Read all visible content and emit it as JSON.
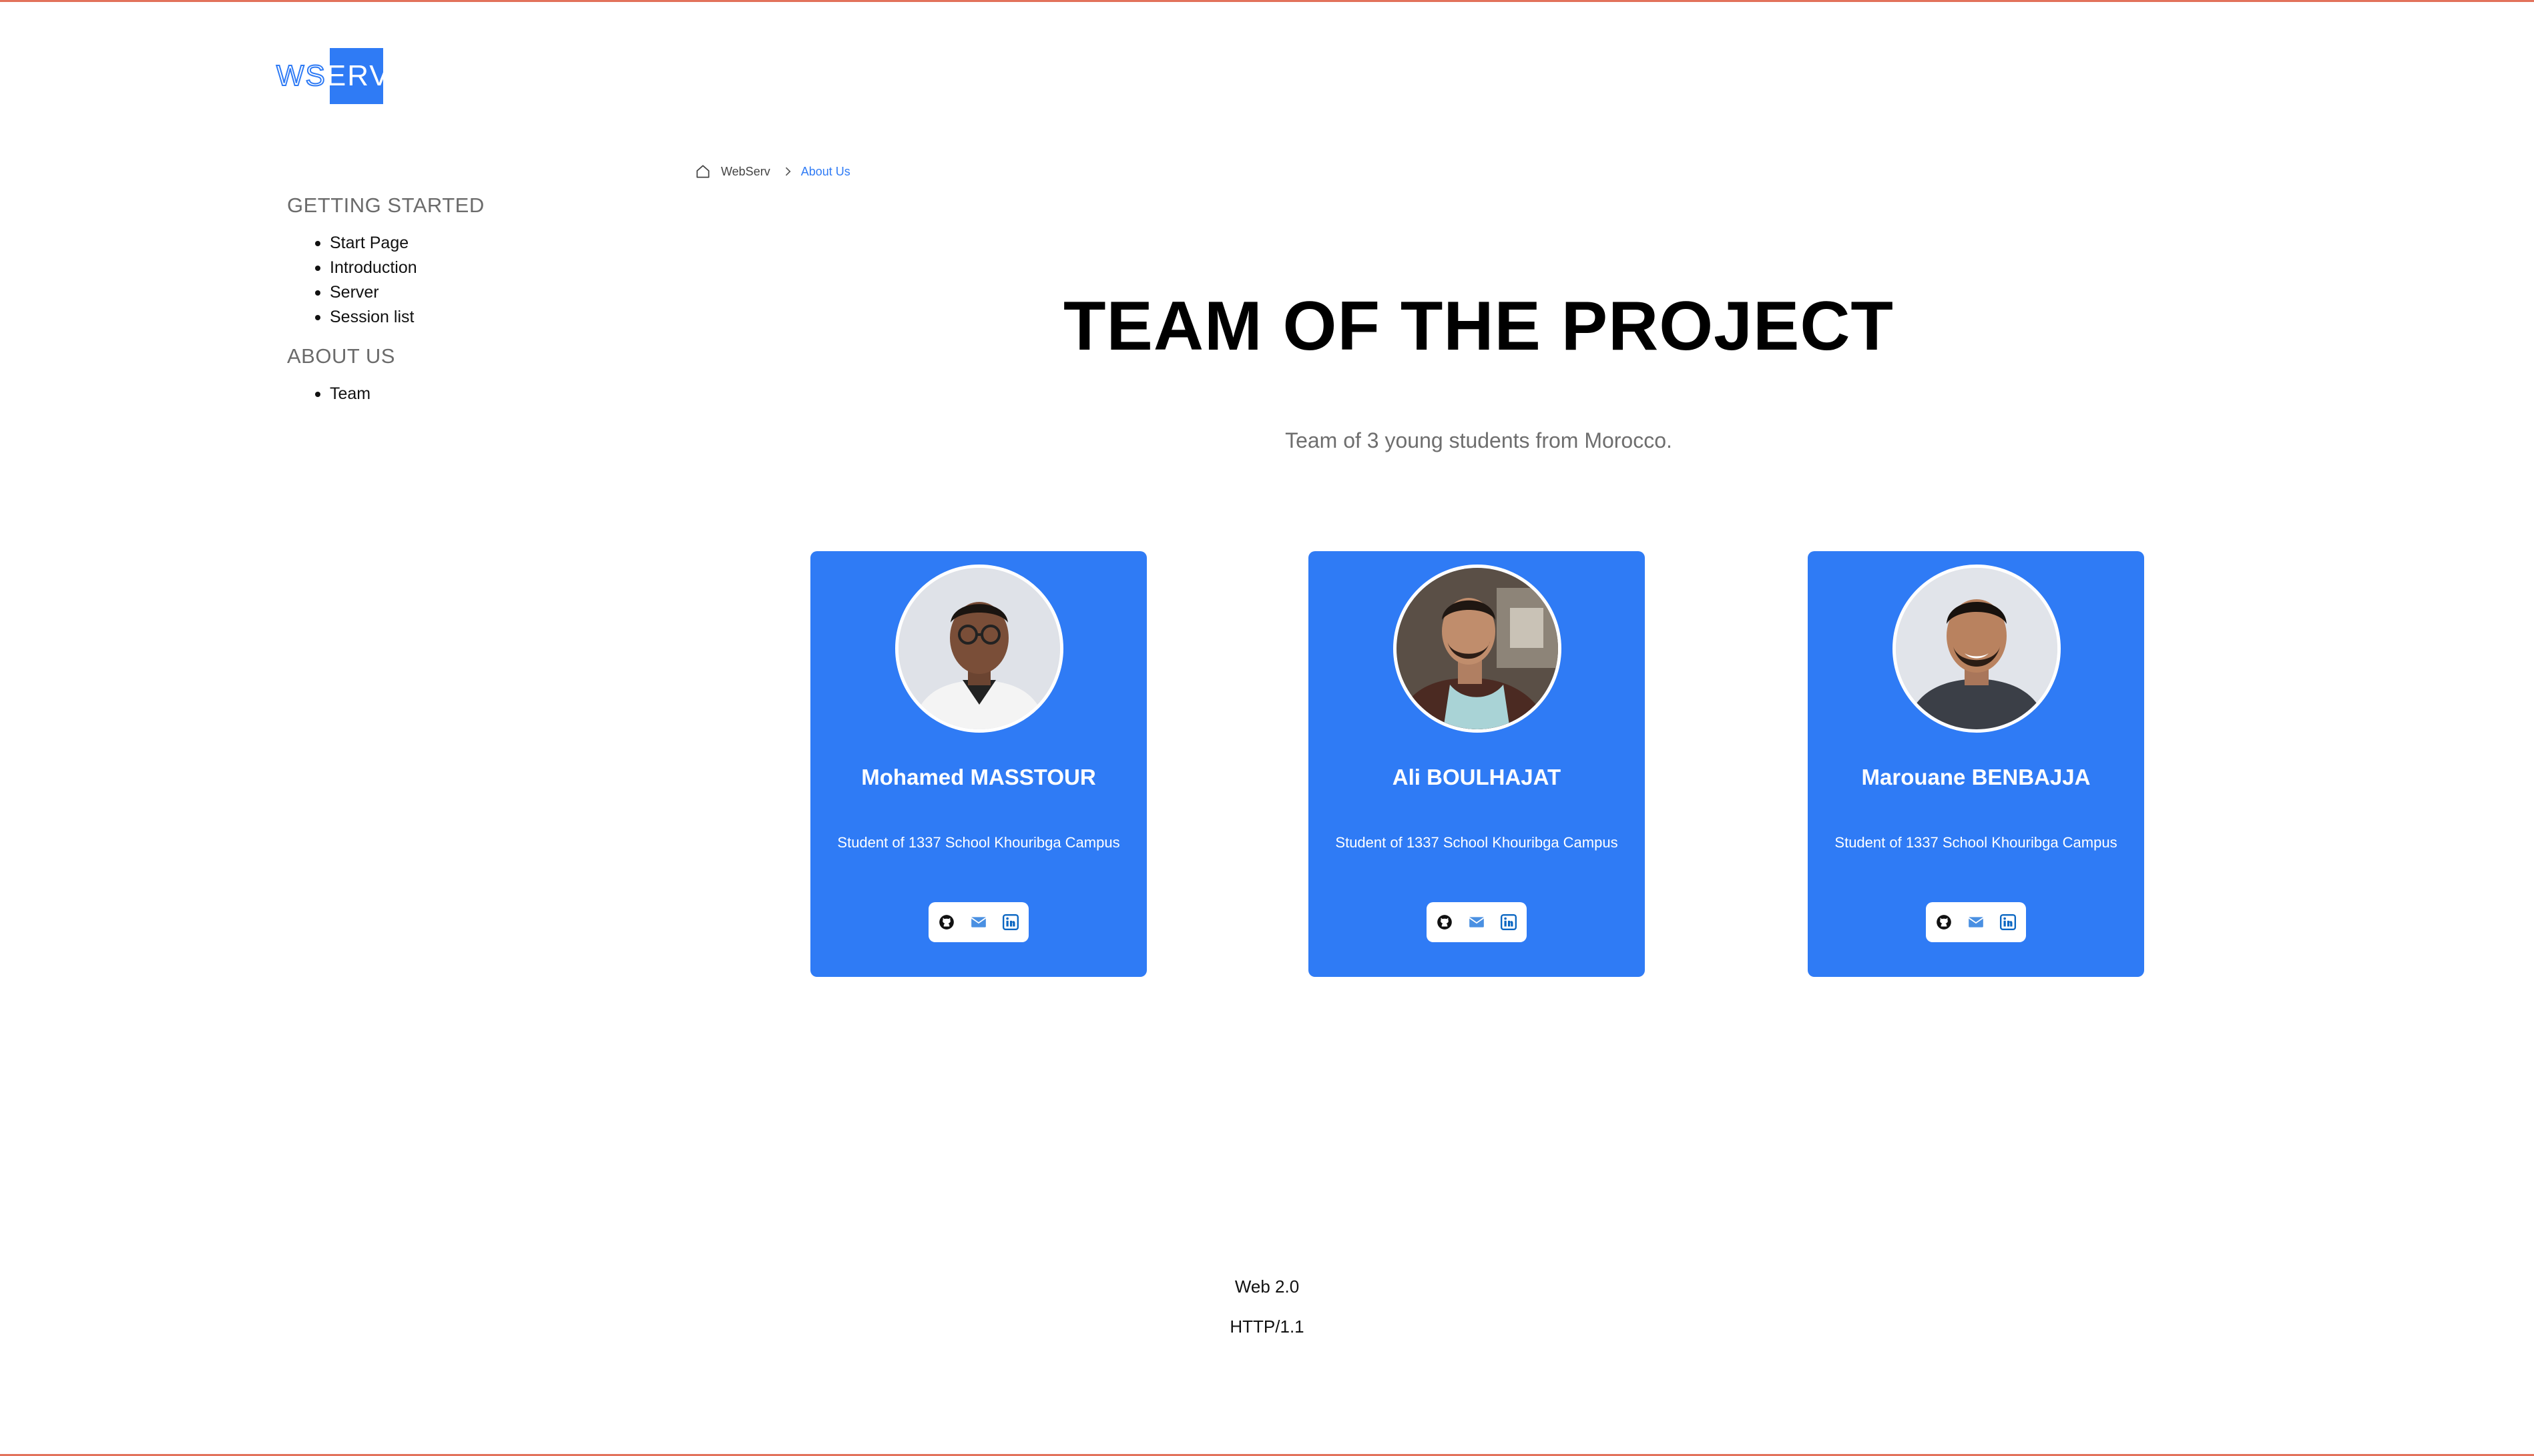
{
  "logo": {
    "part1": "WS",
    "part2": "ERV"
  },
  "sidebar": {
    "sections": [
      {
        "heading": "GETTING STARTED",
        "items": [
          "Start Page",
          "Introduction",
          "Server",
          "Session list"
        ]
      },
      {
        "heading": "ABOUT US",
        "items": [
          "Team"
        ]
      }
    ]
  },
  "breadcrumb": {
    "home": "WebServ",
    "current": "About Us"
  },
  "page": {
    "title": "TEAM OF THE PROJECT",
    "subtitle": "Team of 3 young students from Morocco."
  },
  "team": [
    {
      "name": "Mohamed MASSTOUR",
      "role": "Student of 1337 School Khouribga Campus"
    },
    {
      "name": "Ali BOULHAJAT",
      "role": "Student of 1337 School Khouribga Campus"
    },
    {
      "name": "Marouane BENBAJJA",
      "role": "Student of 1337 School Khouribga Campus"
    }
  ],
  "social_icons": [
    "github-icon",
    "mail-icon",
    "linkedin-icon"
  ],
  "footer": {
    "line1": "Web 2.0",
    "line2": "HTTP/1.1"
  },
  "colors": {
    "accent": "#2f7bf5",
    "frame": "#e2725b",
    "linkedin": "#0a66c2"
  }
}
